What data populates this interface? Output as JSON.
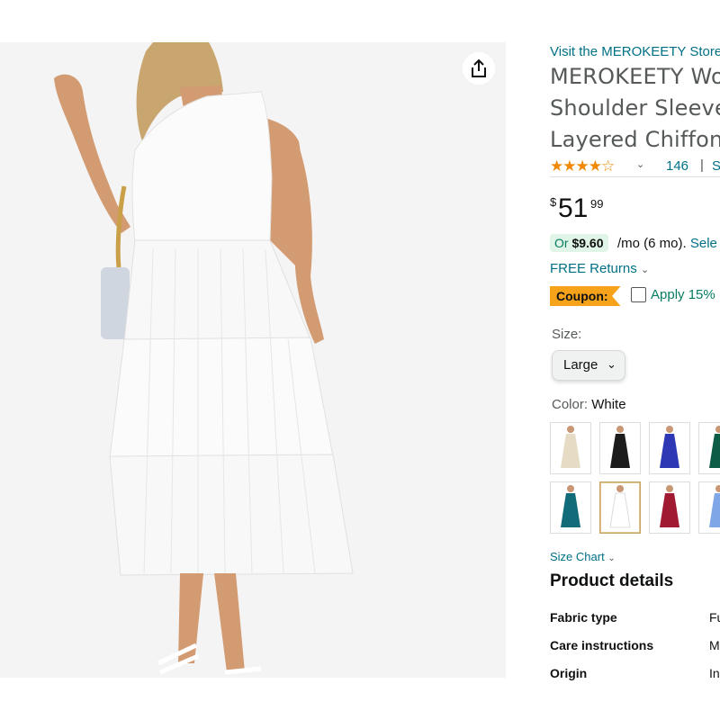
{
  "store_link": "Visit the MEROKEETY Store",
  "title_lines": [
    "MEROKEETY Wo",
    "Shoulder Sleeve",
    "Layered Chiffon"
  ],
  "rating": {
    "stars": 4.0,
    "count": "146",
    "separator": "|",
    "more": "S"
  },
  "price": {
    "symbol": "$",
    "whole": "51",
    "fraction": "99"
  },
  "monthly": {
    "or_label": "Or",
    "amount": "$9.60",
    "term": "/mo (6 mo).",
    "select": "Sele"
  },
  "returns": "FREE Returns",
  "coupon": {
    "tag": "Coupon:",
    "text": "Apply 15%"
  },
  "size": {
    "label": "Size:",
    "value": "Large"
  },
  "color": {
    "label": "Color:",
    "value": "White"
  },
  "swatches": [
    {
      "color": "#e6dcc6"
    },
    {
      "color": "#1c1c1c"
    },
    {
      "color": "#2f38b4"
    },
    {
      "color": "#0d5c46"
    },
    {
      "color": "#116b78"
    },
    {
      "color": "#ffffff",
      "selected": true
    },
    {
      "color": "#a01b32"
    },
    {
      "color": "#7fa6e6"
    }
  ],
  "size_chart": "Size Chart",
  "product_details": {
    "heading": "Product details",
    "rows": [
      {
        "key": "Fabric type",
        "value": "Fu"
      },
      {
        "key": "Care instructions",
        "value": "M"
      },
      {
        "key": "Origin",
        "value": "In"
      }
    ]
  },
  "colors": {
    "link": "#007185",
    "star": "#f08804",
    "coupon": "#f7a21b",
    "green": "#067d62"
  }
}
